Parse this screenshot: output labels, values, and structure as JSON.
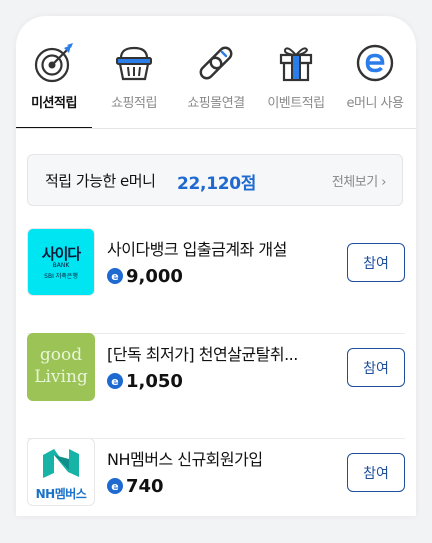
{
  "tabs": [
    {
      "label": "미션적립",
      "icon": "target-icon",
      "active": true
    },
    {
      "label": "쇼핑적립",
      "icon": "basket-icon",
      "active": false
    },
    {
      "label": "쇼핑몰연결",
      "icon": "link-icon",
      "active": false
    },
    {
      "label": "이벤트적립",
      "icon": "gift-icon",
      "active": false
    },
    {
      "label": "e머니 사용",
      "icon": "emoney-icon",
      "active": false
    }
  ],
  "summary": {
    "label": "적립 가능한 e머니",
    "amount": "22,120점",
    "view_all": "전체보기 ›"
  },
  "currency_icon": "e",
  "items": [
    {
      "title": "사이다뱅크 입출금계좌 개설",
      "points": "9,000",
      "button": "참여",
      "thumb": {
        "icon": "saida-bank-logo",
        "brand": "사이다",
        "sub": "BANK",
        "small": "SBI 저축은행",
        "bg": "#00e5f2"
      }
    },
    {
      "title": "[단독 최저가] 천연살균탈취...",
      "points": "1,050",
      "button": "참여",
      "thumb": {
        "icon": "good-living-logo",
        "line1": "good",
        "line2": "Living",
        "bg": "#9bc356"
      }
    },
    {
      "title": "NH멤버스 신규회원가입",
      "points": "740",
      "button": "참여",
      "thumb": {
        "icon": "nh-members-logo",
        "brand": "NH멤버스",
        "bg": "#ffffff"
      }
    }
  ],
  "colors": {
    "accent": "#1f6ad1",
    "button": "#1f4f9c",
    "icon": "#333333",
    "icon_accent": "#2b7de9"
  }
}
